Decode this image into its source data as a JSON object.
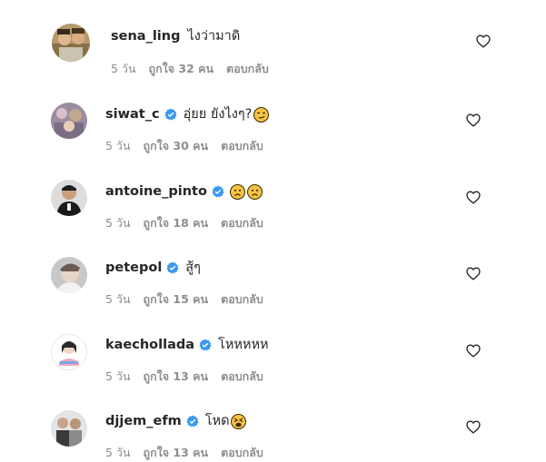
{
  "comments": [
    {
      "username": "sena_ling",
      "verified": false,
      "text": "ไงว่ามาดิ",
      "emojis": [],
      "time": "5 วัน",
      "likes": "ถูกใจ 32 คน",
      "reply": "ตอบกลับ",
      "avatar_icon": "avatar-photo-icon"
    },
    {
      "username": "siwat_c",
      "verified": true,
      "text": "อุ่ยย ยังไงๆ?",
      "emojis": [
        "smirk"
      ],
      "time": "5 วัน",
      "likes": "ถูกใจ 30 คน",
      "reply": "ตอบกลับ",
      "avatar_icon": "avatar-photo-icon"
    },
    {
      "username": "antoine_pinto",
      "verified": true,
      "text": "",
      "emojis": [
        "frown",
        "frown"
      ],
      "time": "5 วัน",
      "likes": "ถูกใจ 18 คน",
      "reply": "ตอบกลับ",
      "avatar_icon": "avatar-photo-icon"
    },
    {
      "username": "petepol",
      "verified": true,
      "text": "สู้ๆ",
      "emojis": [],
      "time": "5 วัน",
      "likes": "ถูกใจ 15 คน",
      "reply": "ตอบกลับ",
      "avatar_icon": "avatar-photo-icon"
    },
    {
      "username": "kaechollada",
      "verified": true,
      "text": "โหหหหห",
      "emojis": [],
      "time": "5 วัน",
      "likes": "ถูกใจ 13 คน",
      "reply": "ตอบกลับ",
      "avatar_icon": "avatar-photo-icon"
    },
    {
      "username": "djjem_efm",
      "verified": true,
      "text": "โหด",
      "emojis": [
        "tired"
      ],
      "time": "5 วัน",
      "likes": "ถูกใจ 13 คน",
      "reply": "ตอบกลับ",
      "avatar_icon": "avatar-photo-icon"
    }
  ],
  "icons": {
    "like": "heart-outline-icon",
    "verified": "verified-badge-icon"
  },
  "colors": {
    "verified": "#3897f0",
    "meta": "#8e8e8e",
    "text": "#262626",
    "emoji": "#f6c342"
  }
}
